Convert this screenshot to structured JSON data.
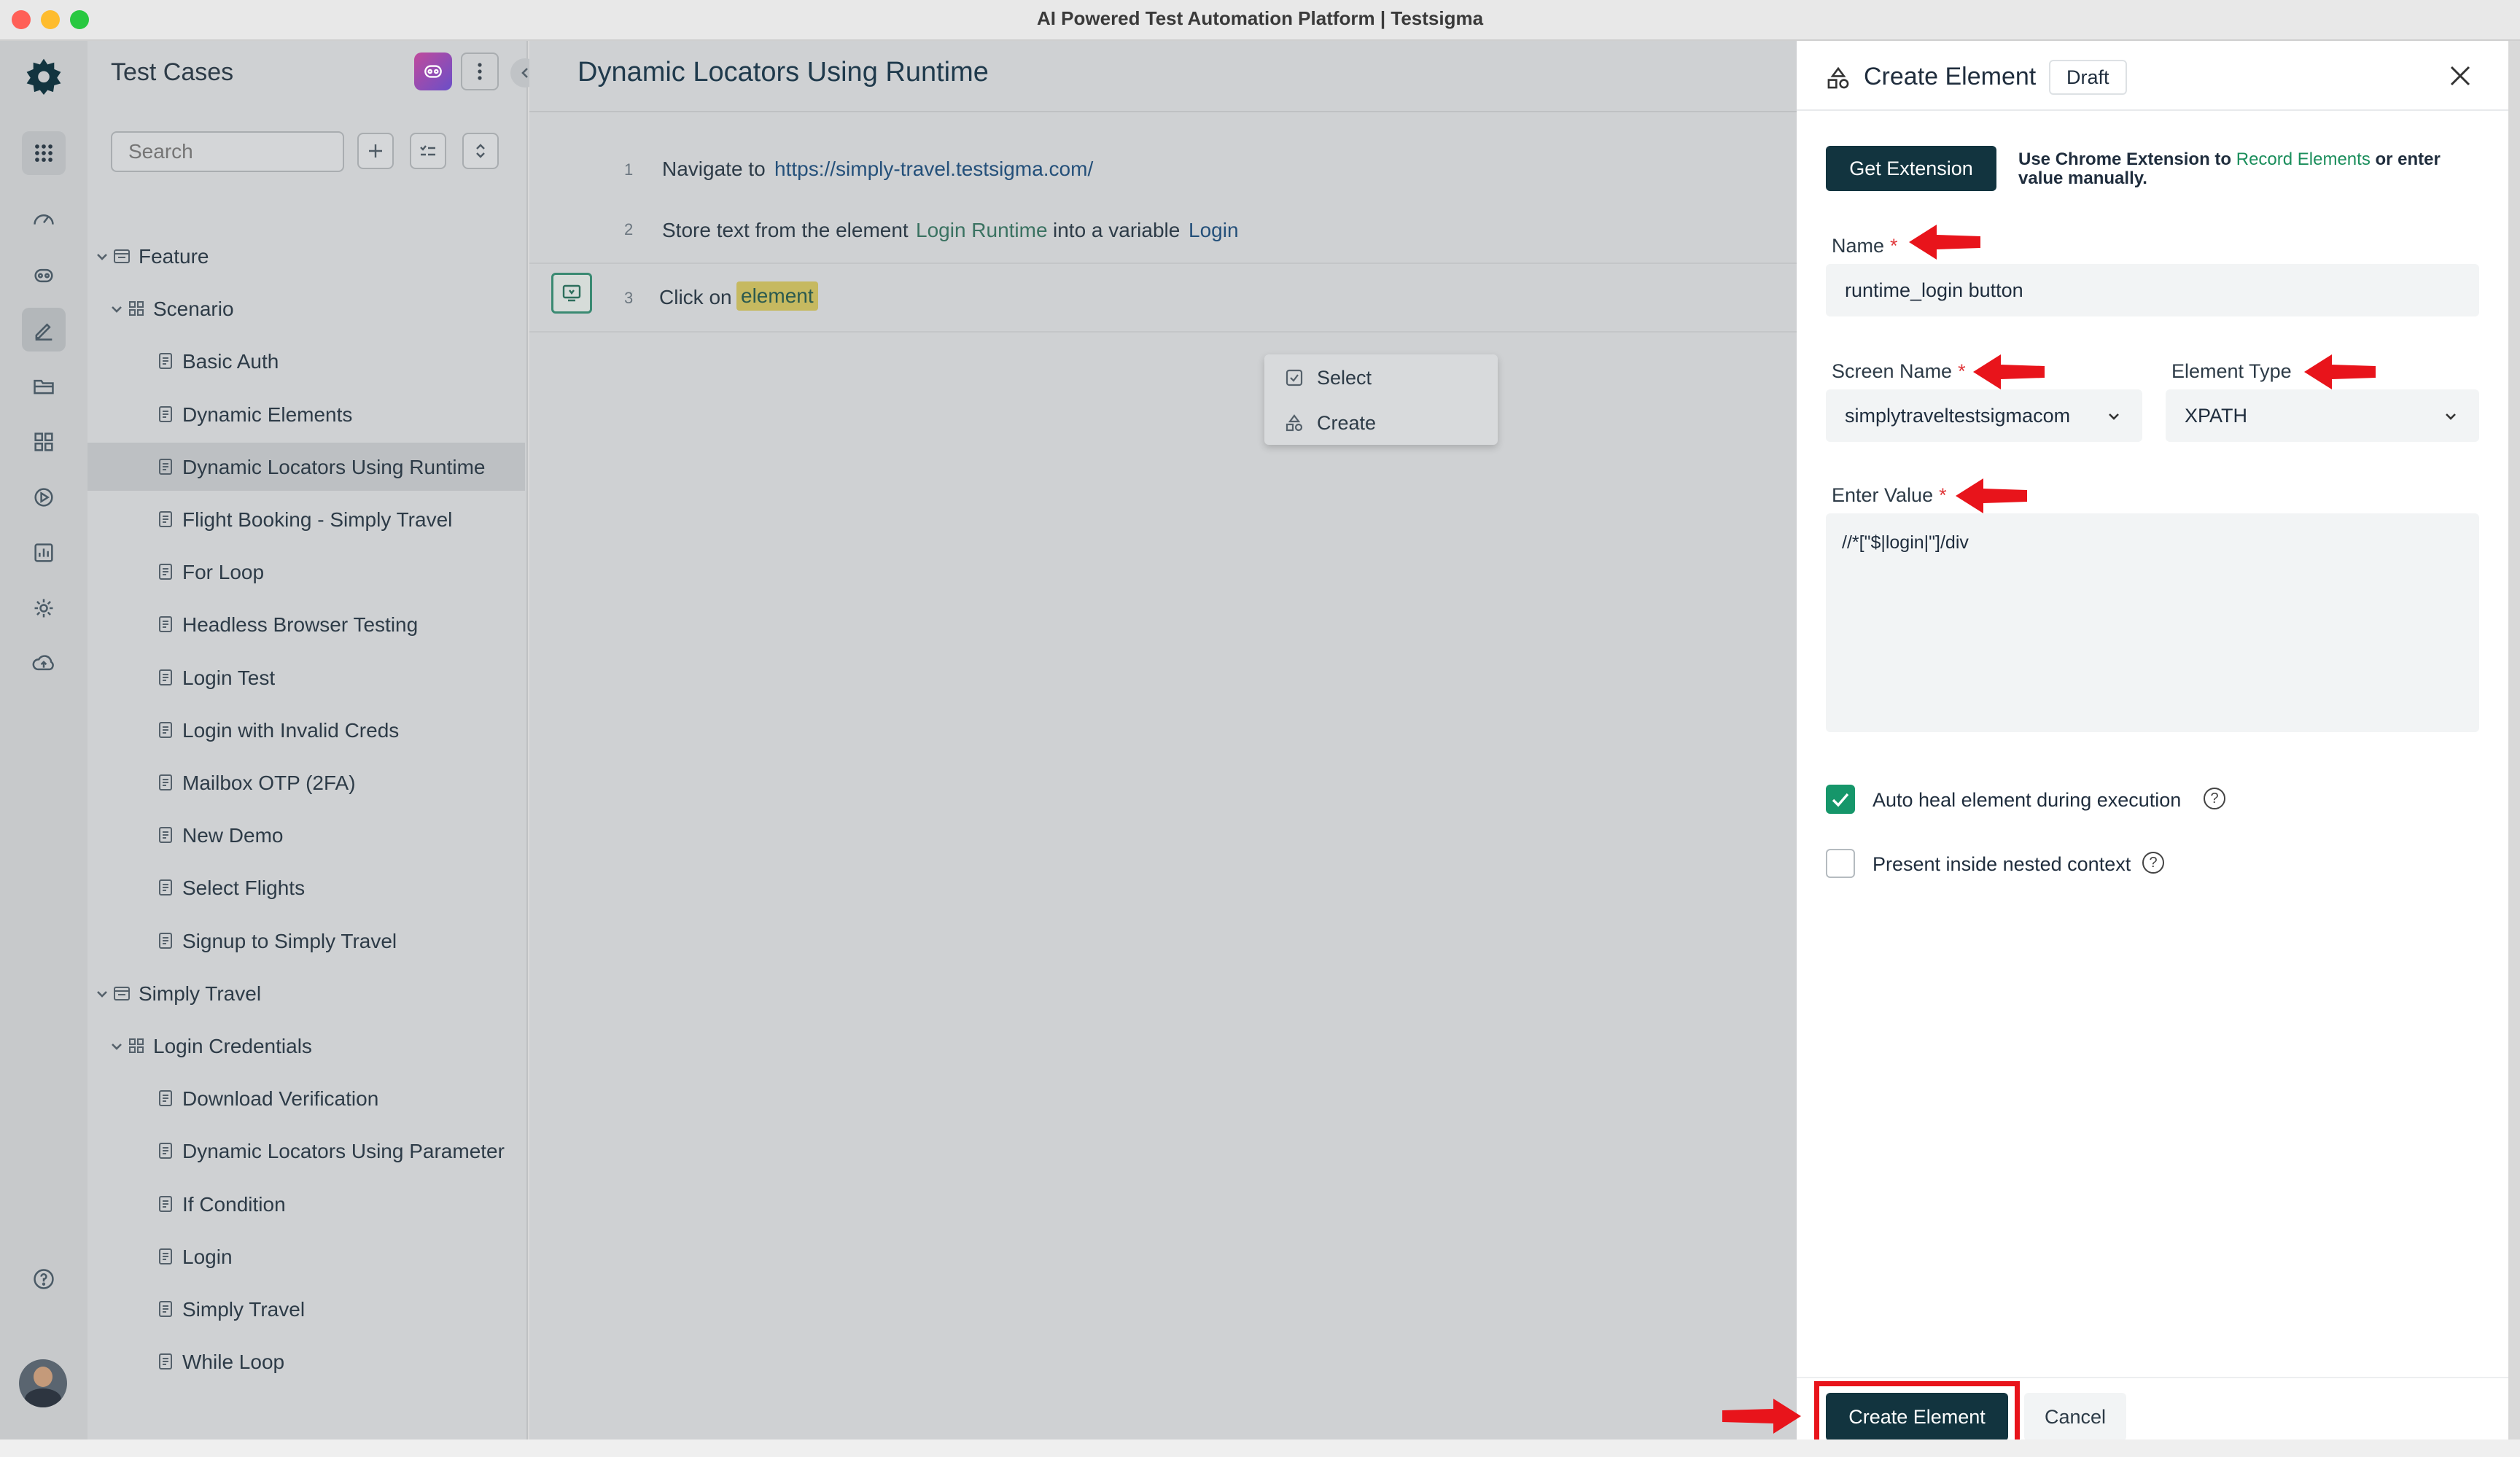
{
  "window": {
    "title": "AI Powered Test Automation Platform | Testsigma",
    "traffic_colors": [
      "#ff5f57",
      "#febc2e",
      "#28c840"
    ]
  },
  "rail": {
    "items": [
      "apps-icon",
      "dashboard-icon",
      "copilot-icon",
      "edit-icon",
      "folder-icon",
      "modules-icon",
      "run-icon",
      "reports-icon",
      "settings-icon",
      "upload-icon",
      "help-icon"
    ],
    "active": "edit-icon"
  },
  "panel": {
    "title": "Test Cases",
    "search_placeholder": "Search",
    "tree": [
      {
        "label": "Feature",
        "type": "group"
      },
      {
        "label": "Scenario",
        "type": "subgroup"
      },
      {
        "label": "Basic Auth",
        "type": "case"
      },
      {
        "label": "Dynamic Elements",
        "type": "case"
      },
      {
        "label": "Dynamic Locators Using Runtime",
        "type": "case"
      },
      {
        "label": "Flight Booking - Simply Travel",
        "type": "case"
      },
      {
        "label": "For Loop",
        "type": "case"
      },
      {
        "label": "Headless Browser Testing",
        "type": "case"
      },
      {
        "label": "Login Test",
        "type": "case"
      },
      {
        "label": "Login with Invalid Creds",
        "type": "case"
      },
      {
        "label": "Mailbox OTP (2FA)",
        "type": "case"
      },
      {
        "label": "New Demo",
        "type": "case"
      },
      {
        "label": "Select Flights",
        "type": "case"
      },
      {
        "label": "Signup to Simply Travel",
        "type": "case"
      },
      {
        "label": "Simply Travel",
        "type": "group"
      },
      {
        "label": "Login Credentials",
        "type": "subgroup"
      },
      {
        "label": "Download Verification",
        "type": "case"
      },
      {
        "label": "Dynamic Locators Using Parameter",
        "type": "case"
      },
      {
        "label": "If Condition",
        "type": "case"
      },
      {
        "label": "Login",
        "type": "case"
      },
      {
        "label": "Simply Travel",
        "type": "case"
      },
      {
        "label": "While Loop",
        "type": "case"
      }
    ],
    "selected": "Dynamic Locators Using Runtime"
  },
  "main": {
    "title": "Dynamic Locators Using Runtime",
    "steps": [
      {
        "num": "1",
        "text": "Navigate to",
        "link": "https://simply-travel.testsigma.com/"
      },
      {
        "num": "2",
        "text": "Store text from the element",
        "element": "Login Runtime",
        "mid": "into a variable",
        "variable": "Login"
      },
      {
        "num": "3",
        "text": "Click on",
        "placeholder": "element"
      }
    ],
    "dropdown": {
      "select": "Select",
      "create": "Create"
    }
  },
  "drawer": {
    "title": "Create Element",
    "badge": "Draft",
    "get_extension": "Get Extension",
    "note_prefix": "Use Chrome Extension to",
    "note_link": "Record Elements",
    "note_suffix": "or enter value manually.",
    "name_label": "Name",
    "name_value": "runtime_login button",
    "screen_label": "Screen Name",
    "screen_value": "simplytraveltestsigmacom",
    "type_label": "Element Type",
    "type_value": "XPATH",
    "value_label": "Enter Value",
    "value_text": "//*[\"$|login|\"]/div",
    "auto_heal_label": "Auto heal element during execution",
    "auto_heal_checked": true,
    "nested_label": "Present inside nested context",
    "nested_checked": false,
    "create_button": "Create Element",
    "cancel_button": "Cancel",
    "required_mark": "*"
  },
  "annotation_color": "#e8141b"
}
